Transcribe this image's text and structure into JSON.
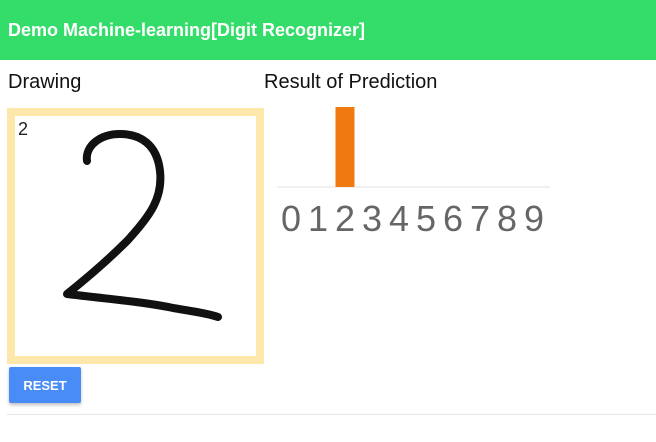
{
  "app": {
    "title": "Demo Machine-learning[Digit Recognizer]",
    "accent": "#34dc6a"
  },
  "drawing": {
    "heading": "Drawing",
    "predicted_label": "2",
    "frame_color": "#fde7aa"
  },
  "result": {
    "heading": "Result of Prediction"
  },
  "controls": {
    "reset_label": "RESET",
    "reset_color": "#4a8cf7"
  },
  "chart_data": {
    "type": "bar",
    "categories": [
      "0",
      "1",
      "2",
      "3",
      "4",
      "5",
      "6",
      "7",
      "8",
      "9"
    ],
    "values": [
      0,
      0,
      1,
      0,
      0,
      0,
      0,
      0,
      0,
      0
    ],
    "ylim": [
      0,
      1
    ],
    "bar_color": "#f07a10",
    "grid": false,
    "title": "",
    "xlabel": "",
    "ylabel": ""
  }
}
